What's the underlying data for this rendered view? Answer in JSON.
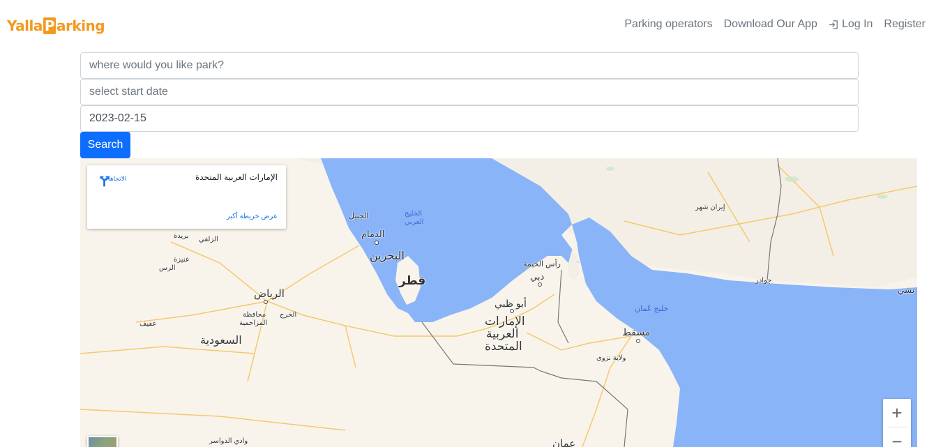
{
  "nav": {
    "logo_left": "Yalla",
    "logo_p": "P",
    "logo_right": "arking",
    "links": [
      "Parking operators",
      "Download Our App",
      "Log In",
      "Register"
    ]
  },
  "search": {
    "location_placeholder": "where would you like park?",
    "start_placeholder": "select start date",
    "end_value": "2023-02-15",
    "button_label": "Search"
  },
  "map": {
    "info_card": {
      "title": "الإمارات العربية المتحدة",
      "directions_label": "الاتجاهات",
      "larger_map_link": "عرض خريطة أكبر"
    },
    "zoom_in": "+",
    "zoom_out": "−",
    "labels": {
      "riyadh": "الرياض",
      "saudi": "السعودية",
      "dammam": "الدمام",
      "jubail": "الجبيل",
      "bahrain": "البحرين",
      "qatar": "قطر",
      "abu_dhabi": "أبو ظبي",
      "uae_1": "الإمارات",
      "uae_2": "العربية",
      "uae_3": "المتحدة",
      "dubai": "دبي",
      "ras_khaimah": "رأس الخيمة",
      "muscat": "مسقط",
      "nizwa": "ولاية نزوى",
      "gulf_oman": "خليج عُمان",
      "arab_gulf_1": "الخليج",
      "arab_gulf_2": "العربي",
      "iranshahr": "إيران شهر",
      "gwadar": "جوادر",
      "buraydah": "بريدة",
      "zulfi": "الزلفي",
      "unaizah": "عنيزة",
      "rass": "الرس",
      "afif": "عفيف",
      "kharj": "الخرج",
      "muzahmiyah_1": "محافظة",
      "muzahmiyah_2": "المزاحمية",
      "wadi_dawasir": "وادي الدواسر",
      "oman": "عمان",
      "panjgur_partial": "نشي"
    }
  }
}
